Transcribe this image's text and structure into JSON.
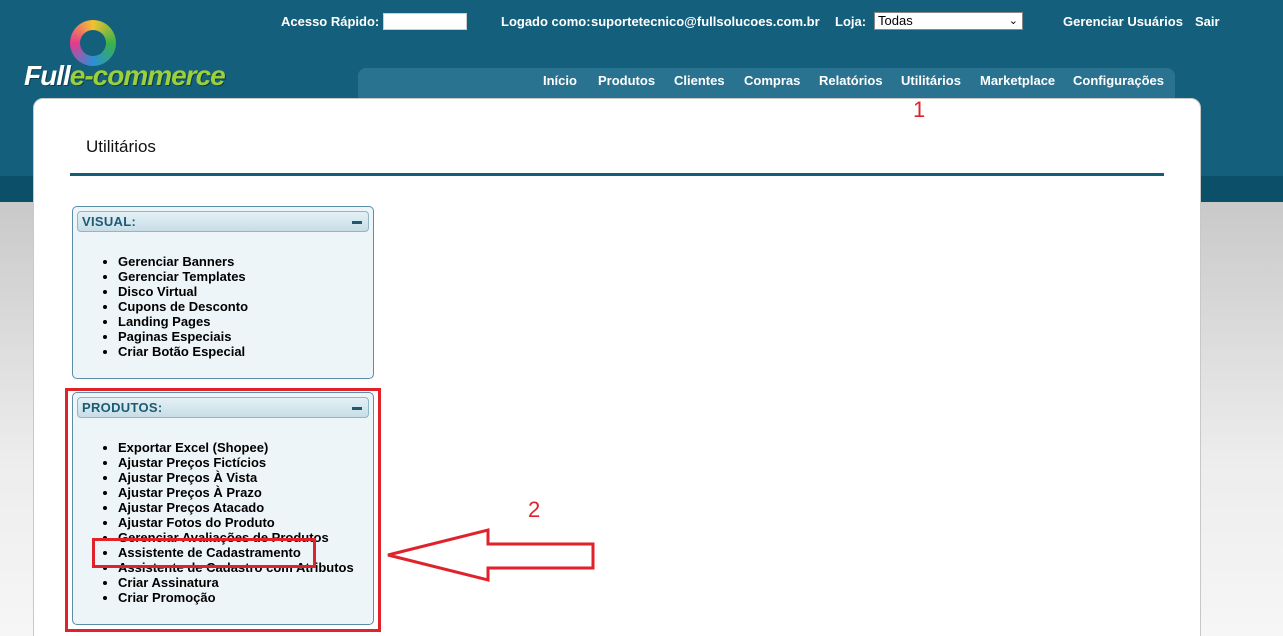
{
  "header": {
    "logo_text_a": "Full",
    "logo_text_b": "e-commerce",
    "quick_access_label": "Acesso Rápido:",
    "quick_access_value": "",
    "logged_as_label": "Logado como:",
    "logged_user": "suportetecnico@fullsolucoes.com.br",
    "store_label": "Loja:",
    "store_selected": "Todas",
    "manage_users": "Gerenciar Usuários",
    "logout": "Sair"
  },
  "nav": {
    "items": [
      "Início",
      "Produtos",
      "Clientes",
      "Compras",
      "Relatórios",
      "Utilitários",
      "Marketplace",
      "Configurações"
    ]
  },
  "page": {
    "title": "Utilitários"
  },
  "sections": [
    {
      "title": "VISUAL:",
      "items": [
        "Gerenciar Banners",
        "Gerenciar Templates",
        "Disco Virtual",
        "Cupons de Desconto",
        "Landing Pages",
        "Paginas Especiais",
        "Criar Botão Especial"
      ]
    },
    {
      "title": "PRODUTOS:",
      "items": [
        "Exportar Excel (Shopee)",
        "Ajustar Preços Fictícios",
        "Ajustar Preços À Vista",
        "Ajustar Preços À Prazo",
        "Ajustar Preços Atacado",
        "Ajustar Fotos do Produto",
        "Gerenciar Avaliações de Produtos",
        "Assistente de Cadastramento",
        "Assistente de Cadastro com Atributos",
        "Criar Assinatura",
        "Criar Promoção"
      ]
    }
  ],
  "annotations": {
    "marker_1": "1",
    "marker_2": "2",
    "color": "#e0222b"
  }
}
